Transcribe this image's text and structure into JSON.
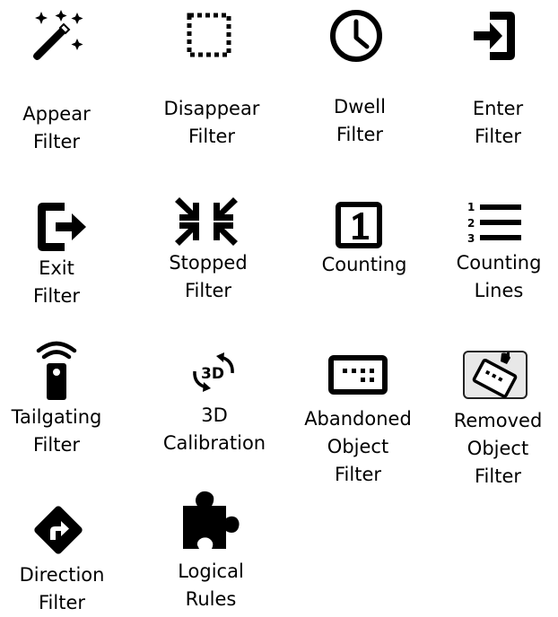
{
  "colors": {
    "icon": "#000000",
    "background": "#ffffff",
    "removed_icon_bg": "#e8e8e8"
  },
  "tiles": [
    {
      "icon": "magic-wand-icon",
      "lines": [
        "Appear",
        "Filter"
      ]
    },
    {
      "icon": "dotted-square-icon",
      "lines": [
        "Disappear",
        "Filter"
      ]
    },
    {
      "icon": "clock-icon",
      "lines": [
        "Dwell",
        "Filter"
      ]
    },
    {
      "icon": "enter-icon",
      "lines": [
        "Enter",
        "Filter"
      ]
    },
    {
      "icon": "exit-icon",
      "lines": [
        "Exit",
        "Filter"
      ]
    },
    {
      "icon": "compress-arrows-icon",
      "lines": [
        "Stopped",
        "Filter"
      ]
    },
    {
      "icon": "counter-one-icon",
      "lines": [
        "Counting"
      ]
    },
    {
      "icon": "numbered-list-icon",
      "lines": [
        "Counting",
        "Lines"
      ]
    },
    {
      "icon": "remote-wifi-icon",
      "lines": [
        "Tailgating",
        "Filter"
      ]
    },
    {
      "icon": "rotate-3d-icon",
      "lines": [
        "3D",
        "Calibration"
      ]
    },
    {
      "icon": "abandoned-object-icon",
      "lines": [
        "Abandoned",
        "Object",
        "Filter"
      ]
    },
    {
      "icon": "removed-object-icon",
      "lines": [
        "Removed",
        "Object",
        "Filter"
      ]
    },
    {
      "icon": "direction-sign-icon",
      "lines": [
        "Direction",
        "Filter"
      ]
    },
    {
      "icon": "puzzle-piece-icon",
      "lines": [
        "Logical",
        "Rules"
      ]
    }
  ]
}
